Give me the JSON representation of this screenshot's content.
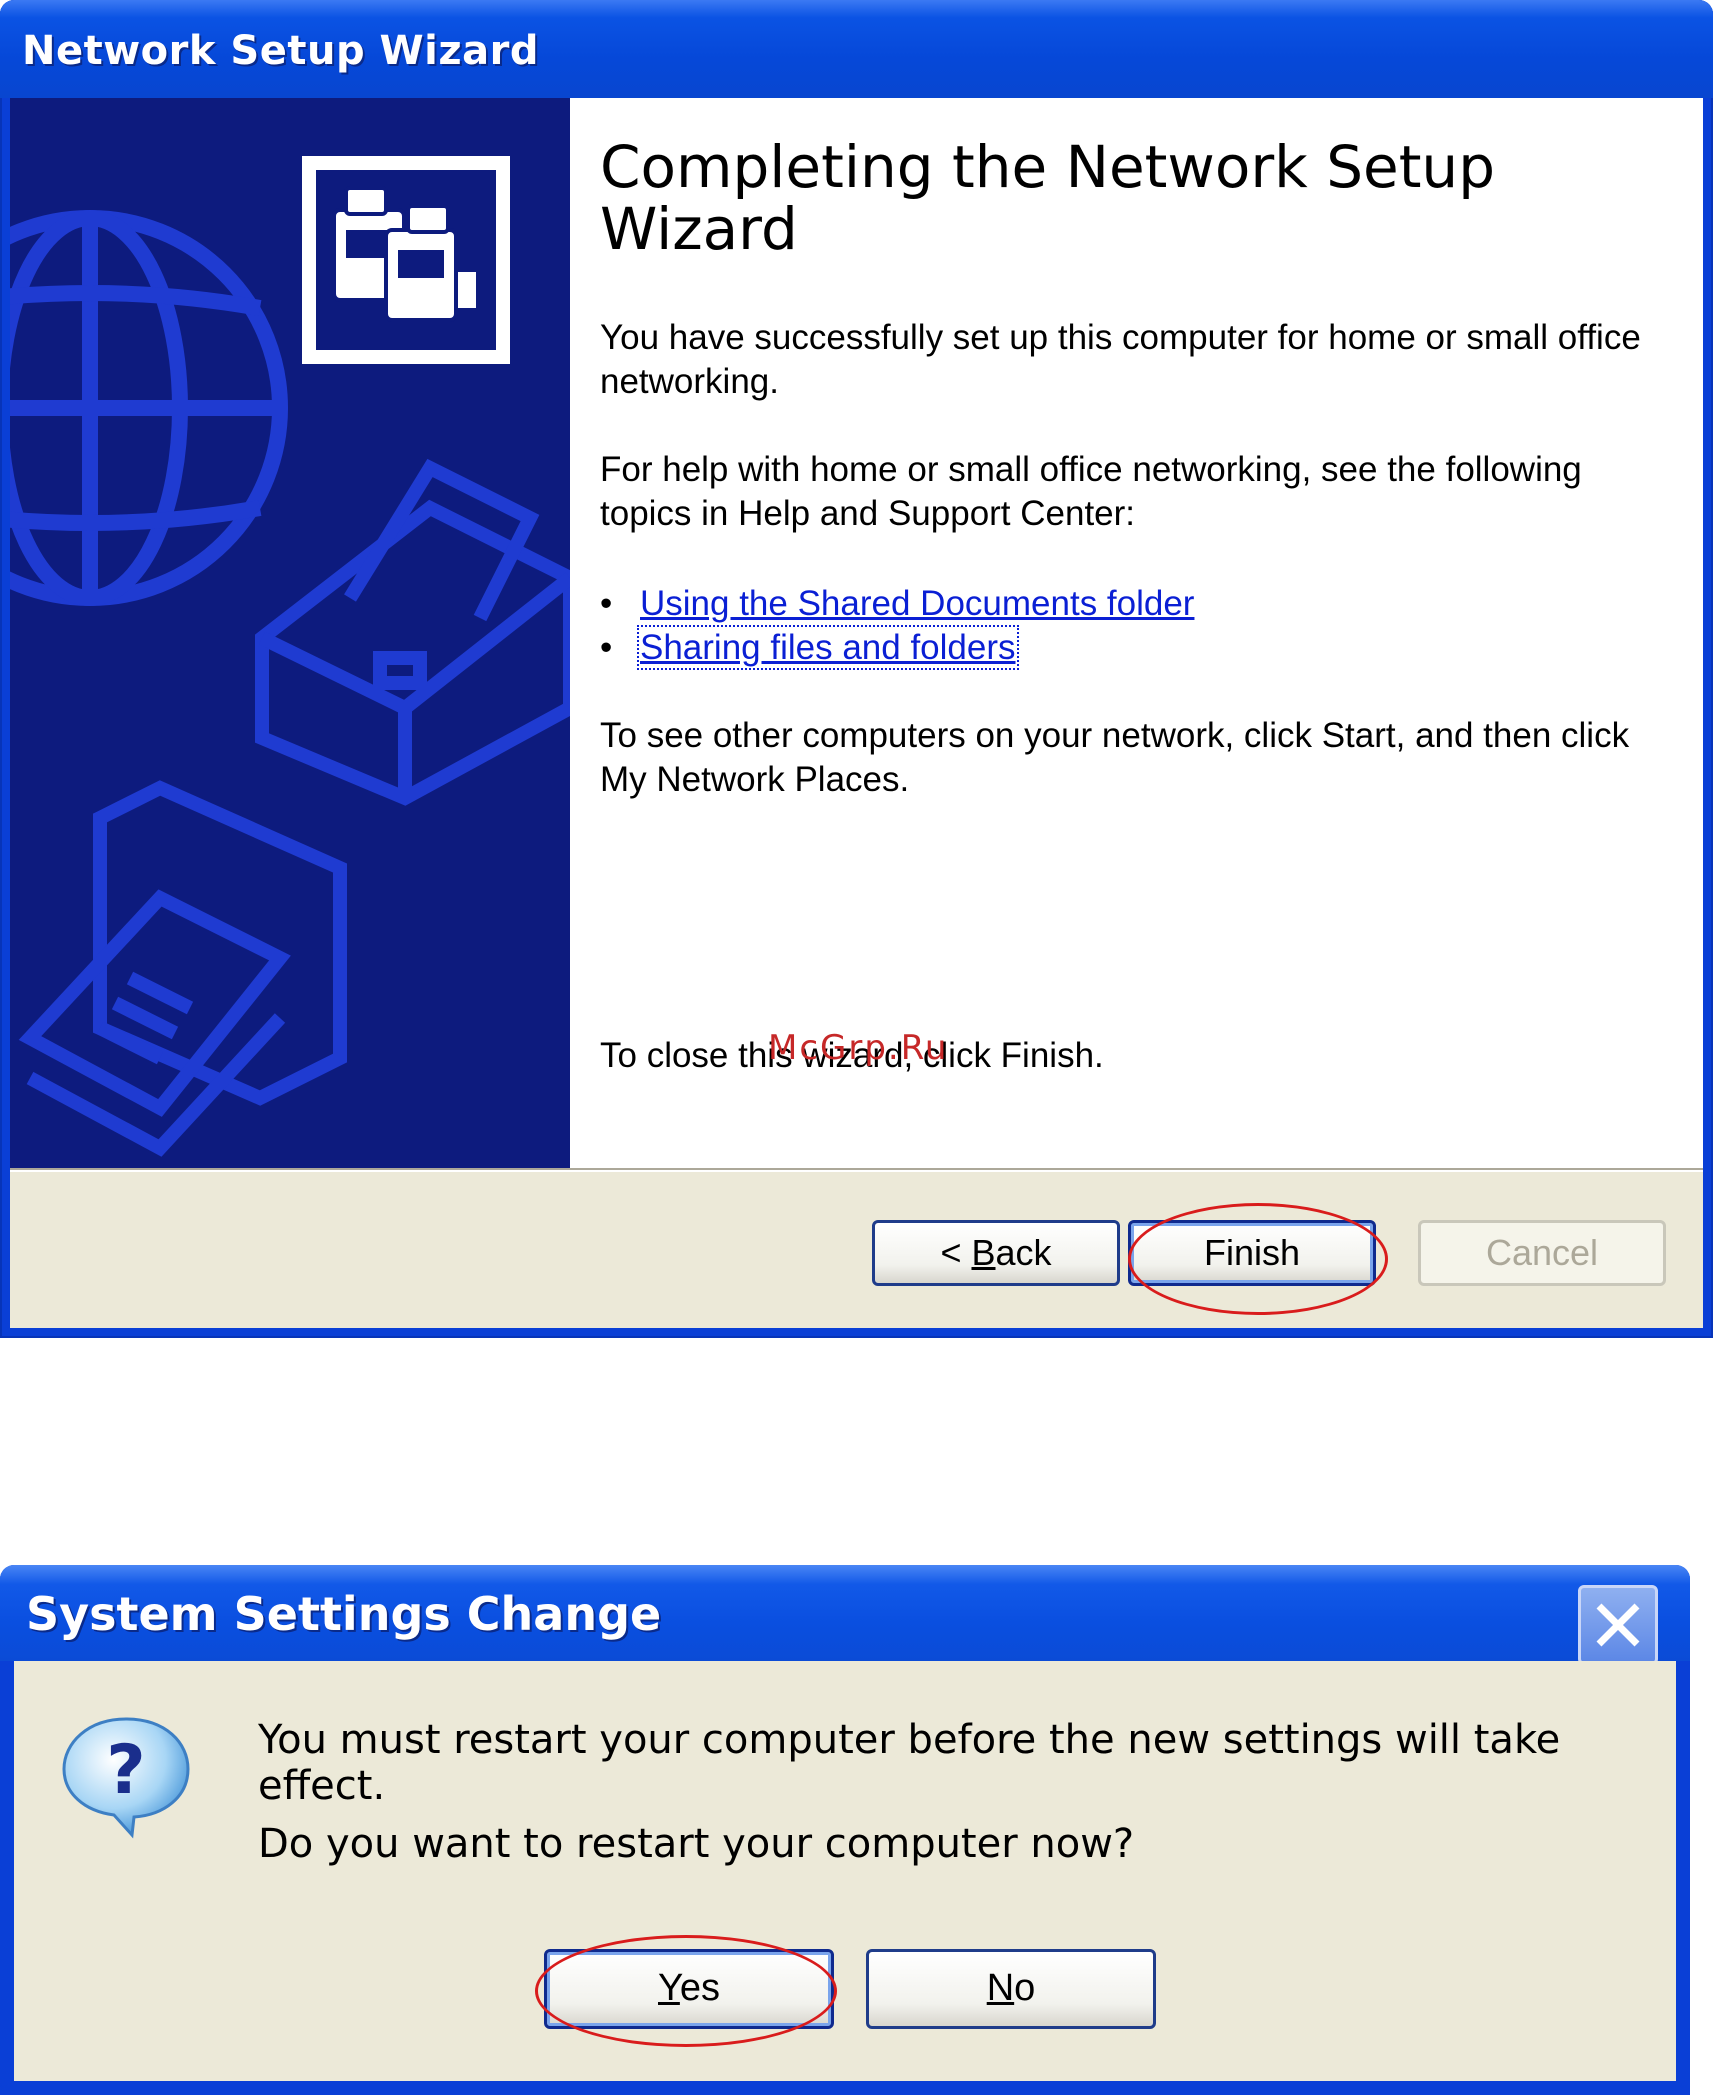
{
  "wizard": {
    "title": "Network Setup Wizard",
    "heading": "Completing the Network Setup Wizard",
    "para_success": "You have successfully set up this computer for home or small office networking.",
    "para_help": "For help with home or small office networking, see the following topics in Help and Support Center:",
    "links": [
      "Using the Shared Documents folder",
      "Sharing files and folders"
    ],
    "para_other": "To see other computers on your network, click Start, and then click My Network Places.",
    "para_close": "To close this wizard, click Finish.",
    "buttons": {
      "back_prefix": "< ",
      "back_accel": "B",
      "back_rest": "ack",
      "finish": "Finish",
      "cancel": "Cancel"
    }
  },
  "watermark": "McGrp.Ru",
  "dialog": {
    "title": "System Settings Change",
    "message": "You must restart your computer before the new settings will take effect.",
    "question": "Do you want to restart your computer now?",
    "buttons": {
      "yes_accel": "Y",
      "yes_rest": "es",
      "no_accel": "N",
      "no_rest": "o"
    }
  },
  "icons": [
    "network-wizard-logo-icon",
    "globe-icon",
    "printer-icon",
    "folder-icon",
    "question-icon",
    "close-icon"
  ],
  "colors": {
    "title_bar": "#0b53e4",
    "side_panel": "#0d1b7e",
    "link": "#0a1fd4",
    "highlight_ellipse": "#d91c1c",
    "dialog_bg": "#ece9d8"
  }
}
